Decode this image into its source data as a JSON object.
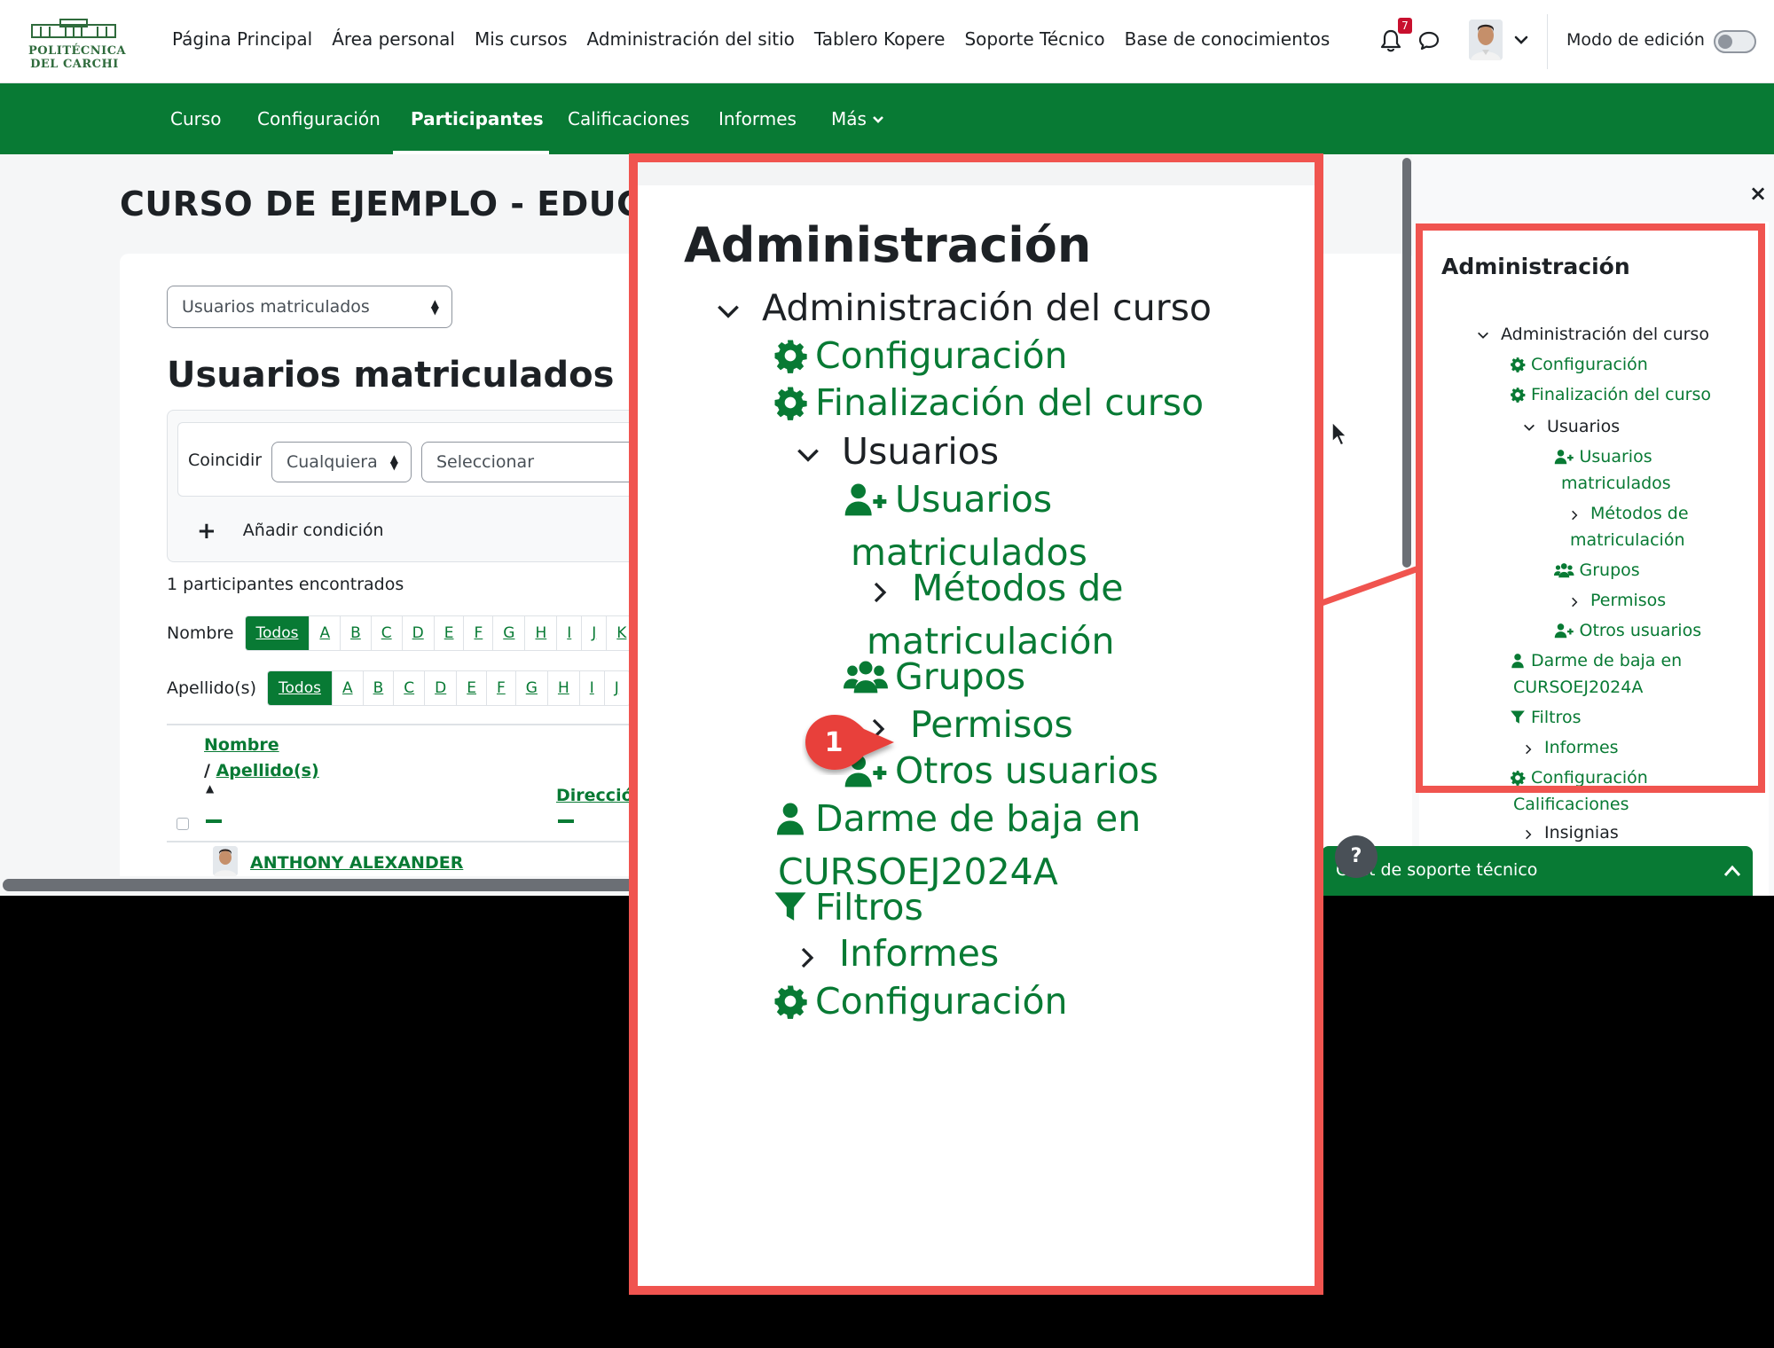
{
  "logo": {
    "line1": "POLITÉCNICA",
    "line2": "DEL CARCHI"
  },
  "topnav": [
    "Página Principal",
    "Área personal",
    "Mis cursos",
    "Administración del sitio",
    "Tablero Kopere",
    "Soporte Técnico",
    "Base de conocimientos"
  ],
  "notifications": {
    "count": "7"
  },
  "edit_mode": {
    "label": "Modo de edición",
    "enabled": false
  },
  "course_nav": {
    "tabs": [
      "Curso",
      "Configuración",
      "Participantes",
      "Calificaciones",
      "Informes",
      "Más"
    ],
    "active": "Participantes"
  },
  "course_title": "CURSO DE EJEMPLO - EDUCAC",
  "participants": {
    "enrol_select": "Usuarios matriculados",
    "heading": "Usuarios matriculados",
    "filter": {
      "match_label": "Coincidir",
      "match_value": "Cualquiera",
      "select_placeholder": "Seleccionar",
      "add_condition": "Añadir condición"
    },
    "found_text": "1 participantes encontrados",
    "first_name_label": "Nombre",
    "last_name_label": "Apellido(s)",
    "first_initials": [
      "Todos",
      "A",
      "B",
      "C",
      "D",
      "E",
      "F",
      "G",
      "H",
      "I",
      "J",
      "K"
    ],
    "last_initials": [
      "Todos",
      "A",
      "B",
      "C",
      "D",
      "E",
      "F",
      "G",
      "H",
      "I",
      "J"
    ],
    "columns": {
      "name": "Nombre",
      "separator": "/",
      "lastname": "Apellido(s)",
      "email": "Direcció"
    },
    "rows": [
      {
        "name": "ANTHONY ALEXANDER"
      }
    ]
  },
  "drawer": {
    "close": "×",
    "title": "Administración",
    "items": [
      {
        "label": "Administración del curso",
        "icon": "chevron-down-icon"
      },
      {
        "label": "Configuración",
        "icon": "gear-icon"
      },
      {
        "label": "Finalización del curso",
        "icon": "gear-icon"
      },
      {
        "label": "Usuarios",
        "icon": "chevron-down-icon"
      },
      {
        "label": "Usuarios",
        "label2": "matriculados",
        "icon": "user-plus-icon"
      },
      {
        "label": "Métodos de",
        "label2": "matriculación",
        "icon": "chevron-right-icon"
      },
      {
        "label": "Grupos",
        "icon": "users-icon"
      },
      {
        "label": "Permisos",
        "icon": "chevron-right-icon"
      },
      {
        "label": "Otros usuarios",
        "icon": "user-plus-icon"
      },
      {
        "label": "Darme de baja en",
        "label2": "CURSOEJ2024A",
        "icon": "user-icon"
      },
      {
        "label": "Filtros",
        "icon": "filter-icon"
      },
      {
        "label": "Informes",
        "icon": "chevron-right-icon"
      },
      {
        "label": "Configuración",
        "label2": "Calificaciones",
        "icon": "gear-icon"
      },
      {
        "label": "Insignias",
        "icon": "chevron-right-icon"
      }
    ]
  },
  "support_chat": {
    "label": "Chat de soporte técnico",
    "help": "?"
  },
  "zoom": {
    "title": "Administración",
    "step": "1",
    "items": [
      {
        "label": "Administración del curso"
      },
      {
        "label": "Configuración"
      },
      {
        "label": "Finalización del curso"
      },
      {
        "label": "Usuarios"
      },
      {
        "label": "Usuarios",
        "label2": "matriculados"
      },
      {
        "label": "Métodos de",
        "label2": "matriculación"
      },
      {
        "label": "Grupos"
      },
      {
        "label": "Permisos"
      },
      {
        "label": "Otros usuarios"
      },
      {
        "label": "Darme de baja en",
        "label2": "CURSOEJ2024A"
      },
      {
        "label": "Filtros"
      },
      {
        "label": "Informes"
      },
      {
        "label": "Configuración"
      }
    ]
  },
  "colors": {
    "brand_green": "#087a34",
    "callout_red": "#f0544f",
    "badge_red": "#c8102e"
  }
}
